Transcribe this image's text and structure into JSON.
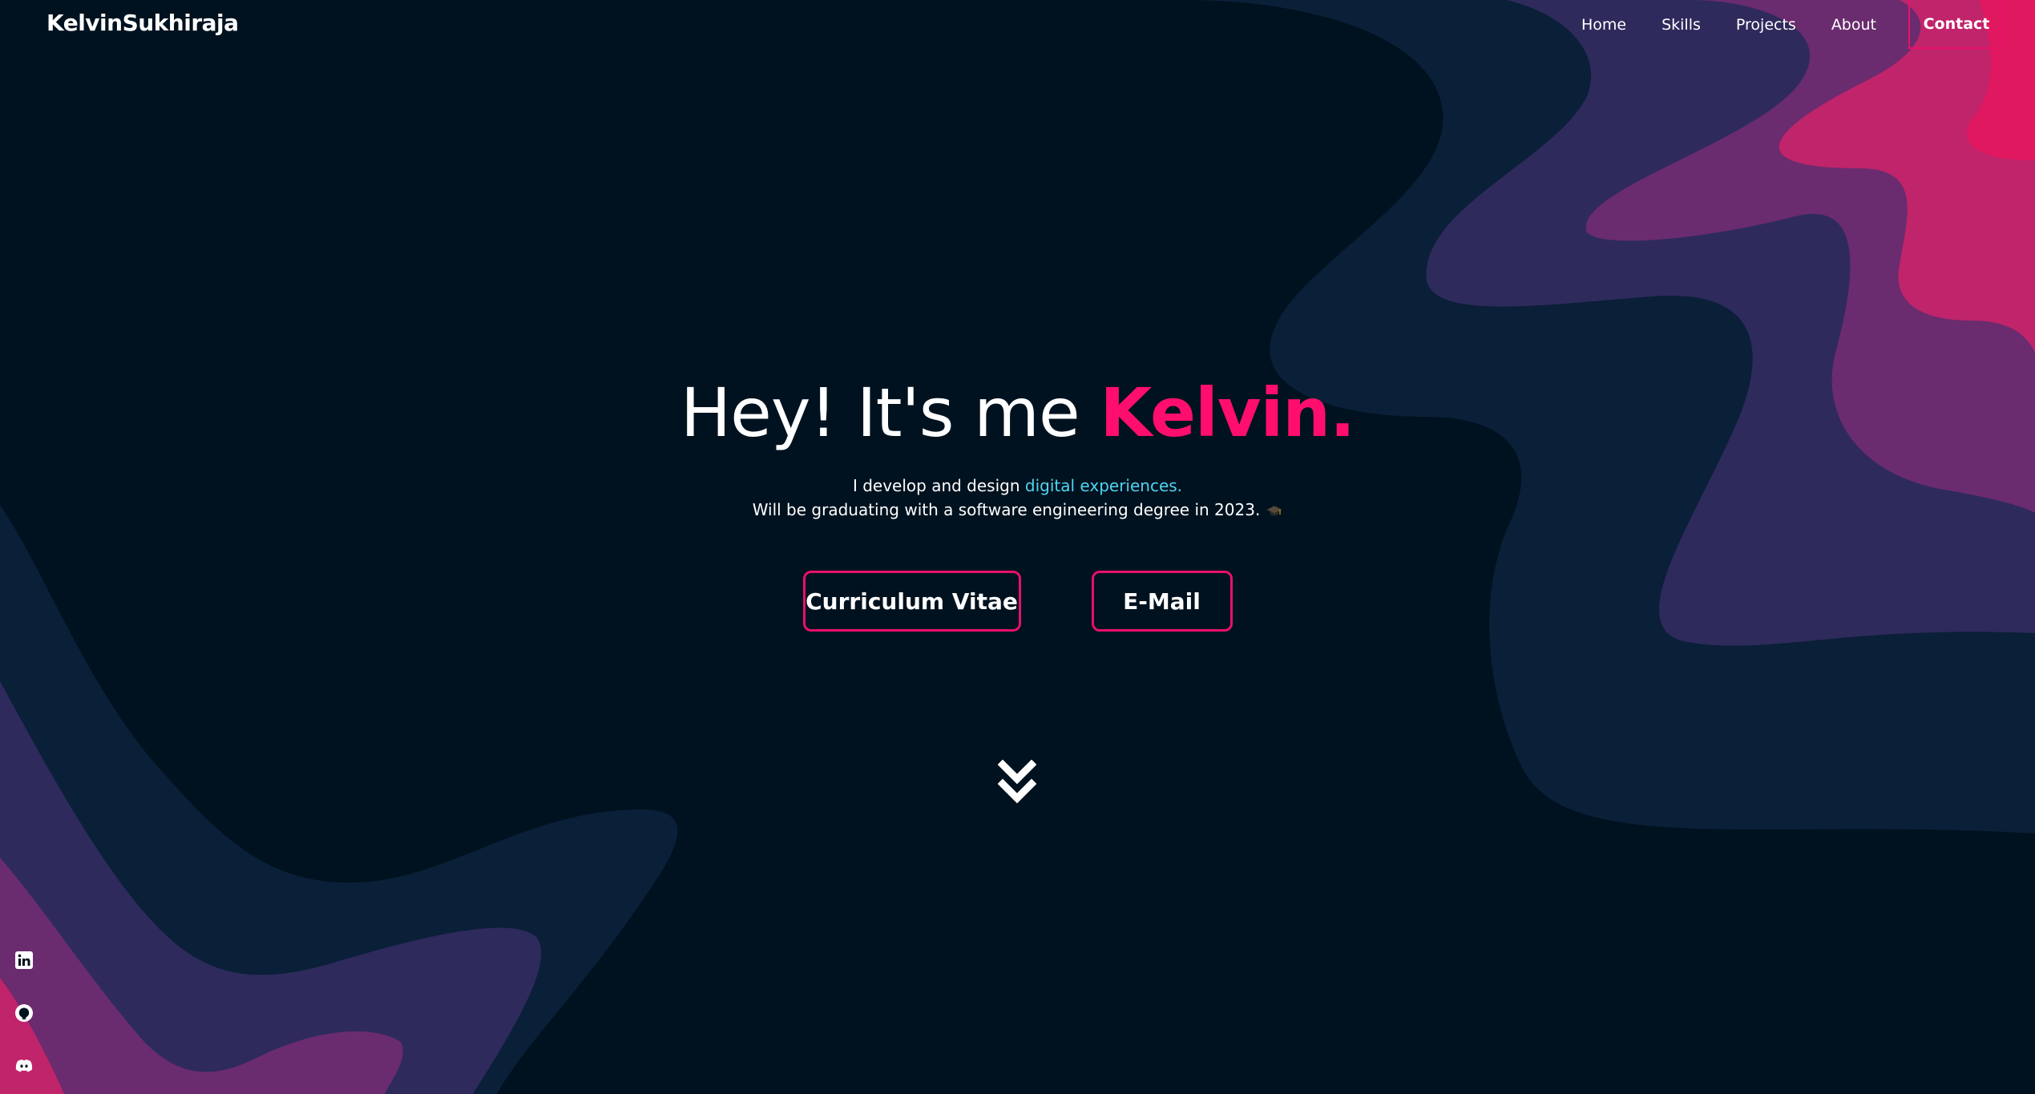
{
  "brand": {
    "logo": "KelvinSukhiraja"
  },
  "nav": {
    "items": [
      "Home",
      "Skills",
      "Projects",
      "About"
    ],
    "contact": "Contact"
  },
  "hero": {
    "greeting": "Hey! It's me ",
    "name": "Kelvin.",
    "line1_prefix": "I develop and design ",
    "line1_highlight": "digital experiences.",
    "line2": "Will be graduating with a software engineering degree in 2023."
  },
  "buttons": {
    "cv": "Curriculum Vitae",
    "email": "E-Mail"
  },
  "icons": {
    "scroll": "chevron-double-down-icon",
    "graduation": "graduation-cap-icon",
    "socials": [
      "linkedin-icon",
      "github-icon",
      "discord-icon"
    ]
  },
  "colors": {
    "background": "#00121f",
    "accent": "#ff0e6d",
    "highlight": "#4fd4f1",
    "wave_dark": "#0a1f38",
    "wave_mid": "#2e2a5c",
    "wave_purple": "#6a2c6e",
    "wave_pink": "#c0246a"
  }
}
